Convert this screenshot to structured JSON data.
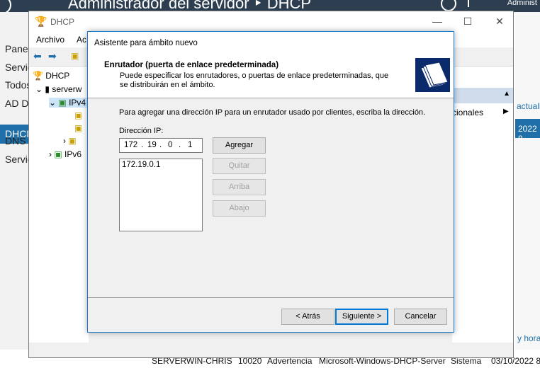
{
  "server_manager": {
    "title": "Administrador del servidor ‣ DHCP",
    "title_right": "Administ",
    "nav_items": [
      "Panel",
      "Servic",
      "Todos",
      "AD D",
      "DHCP",
      "DNS",
      "Servic"
    ],
    "selected_nav": "DHCP",
    "right_fragments": {
      "actualiz": "actualiz",
      "date": "2022 8",
      "hora": "y hora"
    },
    "event_row": {
      "server": "SERVERWIN-CHRIS",
      "id": "10020",
      "severity": "Advertencia",
      "source": "Microsoft-Windows-DHCP-Server",
      "log": "Sistema",
      "date": "03/10/2022 8"
    }
  },
  "mmc": {
    "title": "DHCP",
    "menu": [
      "Archivo",
      "Ac"
    ],
    "tree": {
      "root": "DHCP",
      "server": "serverw",
      "ipv4": "IPv4",
      "ipv6": "IPv6"
    },
    "actions_more": "cionales"
  },
  "wizard": {
    "title": "Asistente para ámbito nuevo",
    "header_title": "Enrutador (puerta de enlace predeterminada)",
    "header_desc": "Puede especificar los enrutadores, o puertas de enlace predeterminadas, que se distribuirán en el ámbito.",
    "instruction": "Para agregar una dirección IP para un enrutador usado por clientes, escriba la dirección.",
    "ip_label": "Dirección IP:",
    "ip_octets": [
      "172",
      "19",
      "0",
      "1"
    ],
    "router_list": [
      "172.19.0.1"
    ],
    "buttons": {
      "add": "Agregar",
      "remove": "Quitar",
      "up": "Arriba",
      "down": "Abajo",
      "back": "< Atrás",
      "next": "Siguiente >",
      "cancel": "Cancelar"
    }
  },
  "colors": {
    "accent": "#1f6fa8",
    "title_bar": "#2d3e50",
    "wizard_border": "#1979ca"
  }
}
